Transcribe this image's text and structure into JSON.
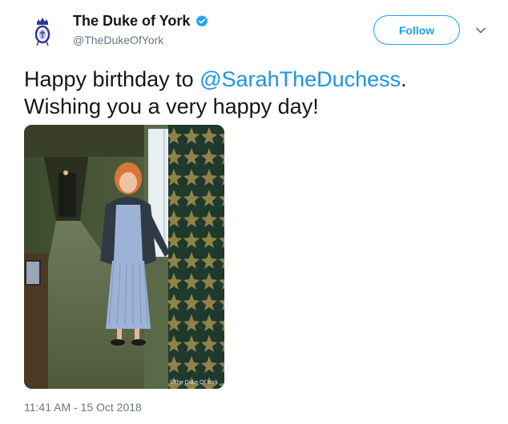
{
  "tweet": {
    "author": {
      "display_name": "The Duke of York",
      "handle": "@TheDukeOfYork",
      "verified": true,
      "avatar_icon": "royal-cypher-icon"
    },
    "follow_label": "Follow",
    "text_before": "Happy birthday to ",
    "mention": "@SarahTheDuchess",
    "text_after": ".",
    "text_line2": "Wishing you a very happy day!",
    "photo_watermark": "©The Duke Of York",
    "timestamp": "11:41 AM - 15 Oct 2018"
  },
  "colors": {
    "accent": "#1da1f2",
    "mention": "#1b95e0",
    "secondary_text": "#657786",
    "primary_text": "#14171a"
  }
}
